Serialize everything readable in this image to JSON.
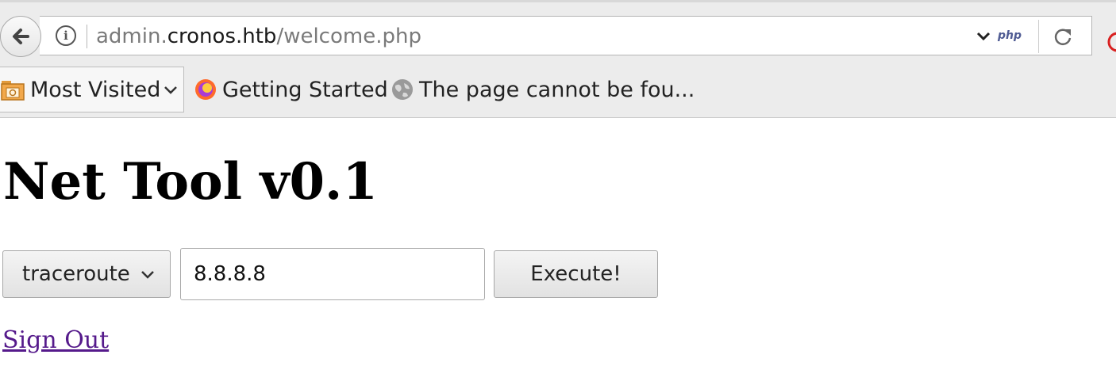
{
  "browser": {
    "url": {
      "prefix": "admin.",
      "host": "cronos.htb",
      "path": "/welcome.php"
    },
    "site_badge": "php",
    "bookmarks": [
      {
        "label": "Most Visited",
        "icon": "folder-icon"
      },
      {
        "label": "Getting Started",
        "icon": "firefox-icon"
      },
      {
        "label": "The page cannot be fou...",
        "icon": "globe-icon"
      }
    ]
  },
  "page": {
    "title": "Net Tool v0.1",
    "command_select": {
      "selected": "traceroute"
    },
    "target_input": {
      "value": "8.8.8.8"
    },
    "execute_label": "Execute!",
    "sign_out_label": "Sign Out"
  },
  "colors": {
    "visited_link": "#551a8b",
    "php_badge": "#4f5b93"
  }
}
